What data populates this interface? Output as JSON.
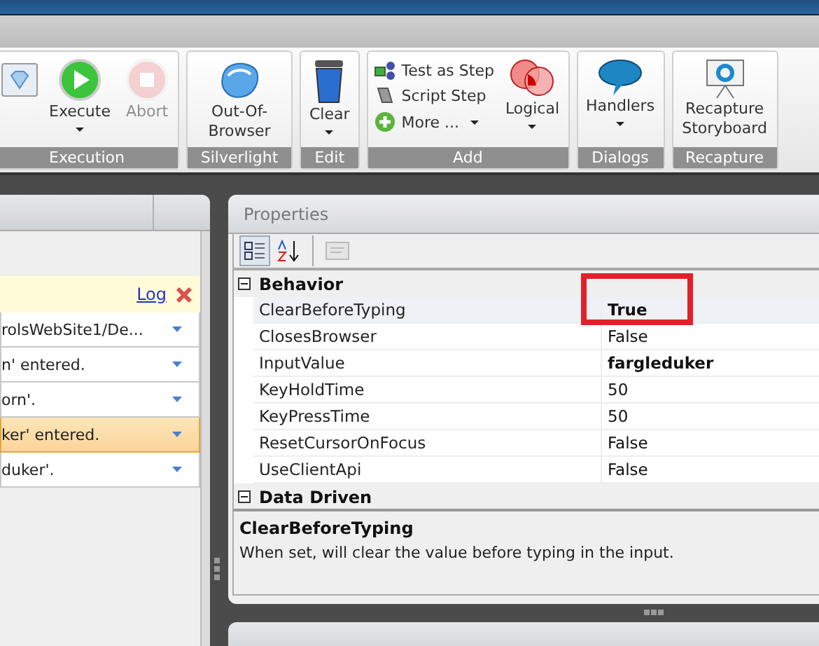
{
  "ribbon": {
    "groups": [
      {
        "label": "Execution",
        "items": [
          {
            "kind": "mini",
            "dropdown": false,
            "disabled": false
          },
          {
            "kind": "large",
            "label": "Execute",
            "dropdown": true,
            "disabled": false
          },
          {
            "kind": "large",
            "label": "Abort",
            "dropdown": false,
            "disabled": true
          }
        ]
      },
      {
        "label": "Silverlight",
        "items": [
          {
            "kind": "large",
            "label": "Out-Of-Browser",
            "dropdown": false,
            "disabled": false
          }
        ]
      },
      {
        "label": "Edit",
        "items": [
          {
            "kind": "large",
            "label": "Clear",
            "dropdown": true,
            "disabled": false
          }
        ]
      },
      {
        "label": "Add",
        "items": [
          {
            "kind": "small",
            "label": "Test as Step",
            "dropdown": false,
            "disabled": false
          },
          {
            "kind": "small",
            "label": "Script Step",
            "dropdown": false,
            "disabled": false
          },
          {
            "kind": "small",
            "label": "More ...",
            "dropdown": true,
            "disabled": false
          },
          {
            "kind": "large",
            "label": "Logical",
            "dropdown": true,
            "disabled": false
          }
        ]
      },
      {
        "label": "Dialogs",
        "items": [
          {
            "kind": "large",
            "label": "Handlers",
            "dropdown": true,
            "disabled": false
          }
        ]
      },
      {
        "label": "Recapture",
        "items": [
          {
            "kind": "large",
            "label": "Recapture Storyboard",
            "dropdown": false,
            "disabled": false
          }
        ]
      }
    ]
  },
  "log_panel": {
    "link": "Log",
    "rows": [
      {
        "text": "rolsWebSite1/De...",
        "selected": false
      },
      {
        "text": "n' entered.",
        "selected": false
      },
      {
        "text": "orn'.",
        "selected": false
      },
      {
        "text": "ker' entered.",
        "selected": true
      },
      {
        "text": "duker'.",
        "selected": false
      }
    ]
  },
  "properties": {
    "title": "Properties",
    "toolbar": [
      {
        "kind": "categorized",
        "selected": true,
        "disabled": false
      },
      {
        "kind": "alphabetical",
        "selected": false,
        "disabled": false
      },
      {
        "kind": "pages",
        "selected": false,
        "disabled": true
      }
    ],
    "categories": [
      {
        "name": "Behavior",
        "expanded": true,
        "rows": [
          {
            "name": "ClearBeforeTyping",
            "value": "True",
            "modified": true,
            "selected": true,
            "annotated": true
          },
          {
            "name": "ClosesBrowser",
            "value": "False",
            "modified": false,
            "selected": false,
            "annotated": false
          },
          {
            "name": "InputValue",
            "value": "fargleduker",
            "modified": true,
            "selected": false,
            "annotated": false
          },
          {
            "name": "KeyHoldTime",
            "value": "50",
            "modified": false,
            "selected": false,
            "annotated": false
          },
          {
            "name": "KeyPressTime",
            "value": "50",
            "modified": false,
            "selected": false,
            "annotated": false
          },
          {
            "name": "ResetCursorOnFocus",
            "value": "False",
            "modified": false,
            "selected": false,
            "annotated": false
          },
          {
            "name": "UseClientApi",
            "value": "False",
            "modified": false,
            "selected": false,
            "annotated": false
          }
        ]
      },
      {
        "name": "Data Driven",
        "expanded": true
      }
    ],
    "description": {
      "title": "ClearBeforeTyping",
      "text": "When set, will clear the value before typing in the input."
    }
  }
}
